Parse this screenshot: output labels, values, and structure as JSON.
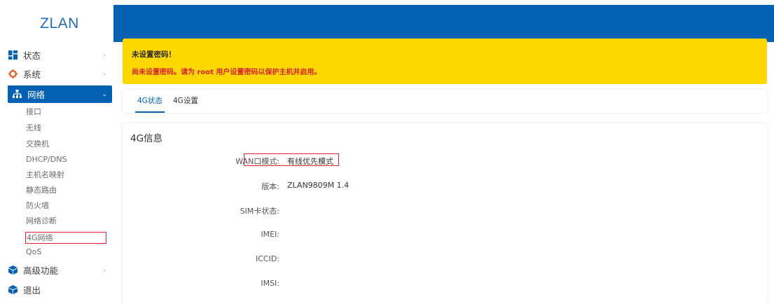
{
  "brand": "ZLAN",
  "sidebar": {
    "status_label": "状态",
    "system_label": "系统",
    "network_label": "网络",
    "network_items": [
      "接口",
      "无线",
      "交换机",
      "DHCP/DNS",
      "主机名映射",
      "静态路由",
      "防火墙",
      "网络诊断",
      "4G网络",
      "QoS"
    ],
    "advanced_label": "高级功能",
    "logout_label": "退出",
    "chevron_right": "›",
    "chevron_down": "⌄"
  },
  "alert": {
    "title": "未设置密码！",
    "message": "尚未设置密码。请为 root 用户设置密码以保护主机并启用。"
  },
  "tabs": [
    "4G状态",
    "4G设置"
  ],
  "info": {
    "title": "4G信息",
    "rows": [
      {
        "label": "WAN口模式:",
        "value": "有线优先模式"
      },
      {
        "label": "版本:",
        "value": "ZLAN9809M 1.4"
      },
      {
        "label": "SIM卡状态:",
        "value": ""
      },
      {
        "label": "IMEI:",
        "value": ""
      },
      {
        "label": "ICCID:",
        "value": ""
      },
      {
        "label": "IMSI:",
        "value": ""
      }
    ]
  },
  "colors": {
    "primary": "#0461b3",
    "warning": "#ffd700",
    "danger": "#d9232c",
    "highlight": "#e0242a"
  }
}
